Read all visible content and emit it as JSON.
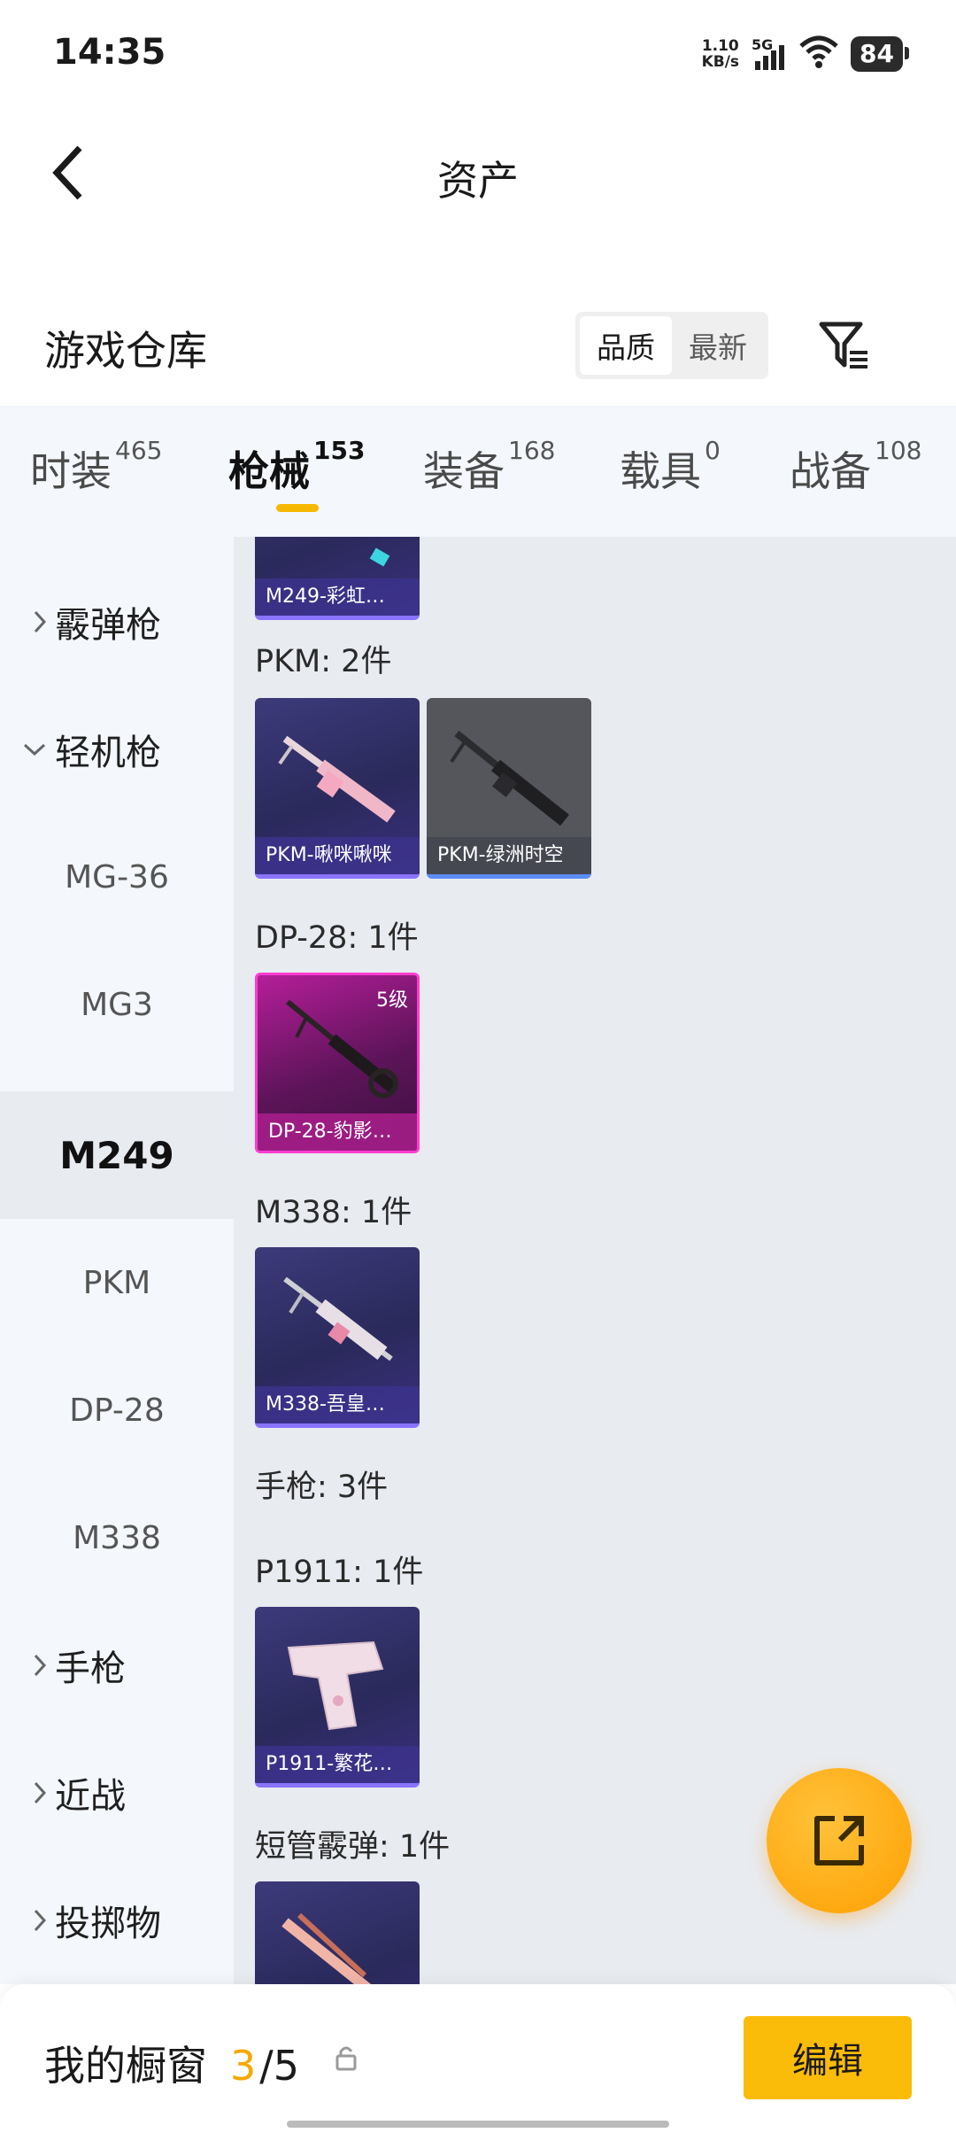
{
  "status_bar": {
    "time": "14:35",
    "speed_value": "1.10",
    "speed_unit": "KB/s",
    "network": "5G",
    "battery": "84"
  },
  "header": {
    "title": "资产",
    "back_icon": "chevron-left-icon"
  },
  "section": {
    "title": "游戏仓库",
    "sort_options": [
      "品质",
      "最新"
    ],
    "filter_icon": "filter-list-icon"
  },
  "tabs": [
    {
      "label": "时装",
      "count": "465"
    },
    {
      "label": "枪械",
      "count": "153"
    },
    {
      "label": "装备",
      "count": "168"
    },
    {
      "label": "载具",
      "count": "0"
    },
    {
      "label": "战备",
      "count": "108"
    }
  ],
  "sidebar": {
    "categories": [
      "霰弹枪",
      "轻机枪",
      "手枪",
      "近战",
      "投掷物"
    ],
    "subitems": [
      "MG-36",
      "MG3",
      "M249",
      "PKM",
      "DP-28",
      "M338"
    ]
  },
  "content": {
    "groups": [
      {
        "label": "PKM: 2件"
      },
      {
        "label": "DP-28: 1件"
      },
      {
        "label": "M338: 1件"
      },
      {
        "label": "手枪: 3件"
      },
      {
        "label": "P1911: 1件"
      },
      {
        "label": "短管霰弹: 1件"
      }
    ],
    "cards": [
      {
        "name": "M249-彩虹…"
      },
      {
        "name": "PKM-啾咪啾咪"
      },
      {
        "name": "PKM-绿洲时空"
      },
      {
        "name": "DP-28-豹影…",
        "level": "5级"
      },
      {
        "name": "M338-吾皇…"
      },
      {
        "name": "P1911-繁花…"
      }
    ]
  },
  "bottom": {
    "label": "我的橱窗",
    "current": "3",
    "total": "/5",
    "edit": "编辑"
  },
  "colors": {
    "accent": "#fbbc09",
    "purple_card": "#2a2a5c",
    "pink_card": "#b51e9a"
  }
}
